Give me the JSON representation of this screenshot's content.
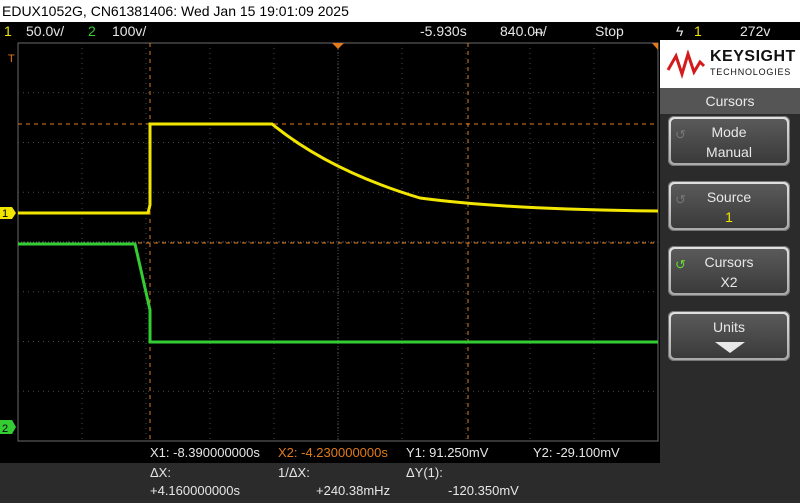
{
  "title_bar": {
    "text": "EDUX1052G, CN61381406: Wed Jan 15 19:01:09 2025"
  },
  "status": {
    "ch1_num": "1",
    "ch1_scale": "50.0ᴠ/",
    "ch2_num": "2",
    "ch2_scale": "100ᴠ/",
    "time_offset": "-5.930s",
    "time_scale": "840.0ᵰ/",
    "run_state": "Stop",
    "trigger_symbol": "ϟ",
    "trigger_source": "1",
    "trigger_level": "272ᴠ"
  },
  "markers": {
    "ch1": "1",
    "ch2": "2",
    "trig": "T"
  },
  "panel": {
    "brand": "KEYSIGHT",
    "brand_sub": "TECHNOLOGIES",
    "menu_title": "Cursors",
    "softkeys": [
      {
        "label": "Mode",
        "value": "Manual"
      },
      {
        "label": "Source",
        "value": "1"
      },
      {
        "label": "Cursors",
        "value": "X2"
      },
      {
        "label": "Units",
        "value": ""
      }
    ]
  },
  "readout": {
    "x1": "X1: -8.390000000s",
    "x2": "X2: -4.230000000s",
    "y1": "Y1:  91.250mV",
    "y2": "Y2: -29.100mV",
    "dx_label": "ΔX:",
    "dx_value": "+4.160000000s",
    "inv_dx_label": "1/ΔX:",
    "inv_dx_value": "+240.38mHz",
    "dy_label": "ΔY(1):",
    "dy_value": "-120.350mV"
  },
  "colors": {
    "ch1": "#f2e600",
    "ch2": "#33cc33",
    "cursor": "#e07a1a",
    "grid": "#5a5a5a"
  }
}
